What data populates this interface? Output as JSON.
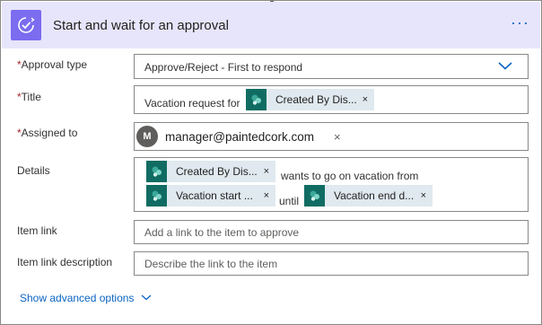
{
  "header": {
    "title": "Start and wait for an approval",
    "menu_label": "···",
    "icon": "approval-check-icon",
    "accent_color": "#7b6cf0",
    "background_color": "#e7e5fb"
  },
  "fields": {
    "approval_type": {
      "label": "Approval type",
      "required_mark": "*",
      "value": "Approve/Reject - First to respond"
    },
    "title": {
      "label": "Title",
      "required_mark": "*",
      "prefix_text": "Vacation request for",
      "token": "Created By Dis...",
      "token_remove": "×"
    },
    "assigned_to": {
      "label": "Assigned to",
      "required_mark": "*",
      "avatar_initial": "M",
      "email": "manager@paintedcork.com",
      "remove": "×"
    },
    "details": {
      "label": "Details",
      "token1": "Created By Dis...",
      "text1": "wants to go on vacation from",
      "token2": "Vacation start ...",
      "text2": "until",
      "token3": "Vacation end d...",
      "token_remove": "×"
    },
    "item_link": {
      "label": "Item link",
      "placeholder": "Add a link to the item to approve"
    },
    "item_link_description": {
      "label": "Item link description",
      "placeholder": "Describe the link to the item"
    }
  },
  "advanced": {
    "label": "Show advanced options",
    "icon": "chevron-down-icon"
  },
  "token_icon": "sharepoint-icon",
  "token_color": "#106c62",
  "link_color": "#0b64c2"
}
